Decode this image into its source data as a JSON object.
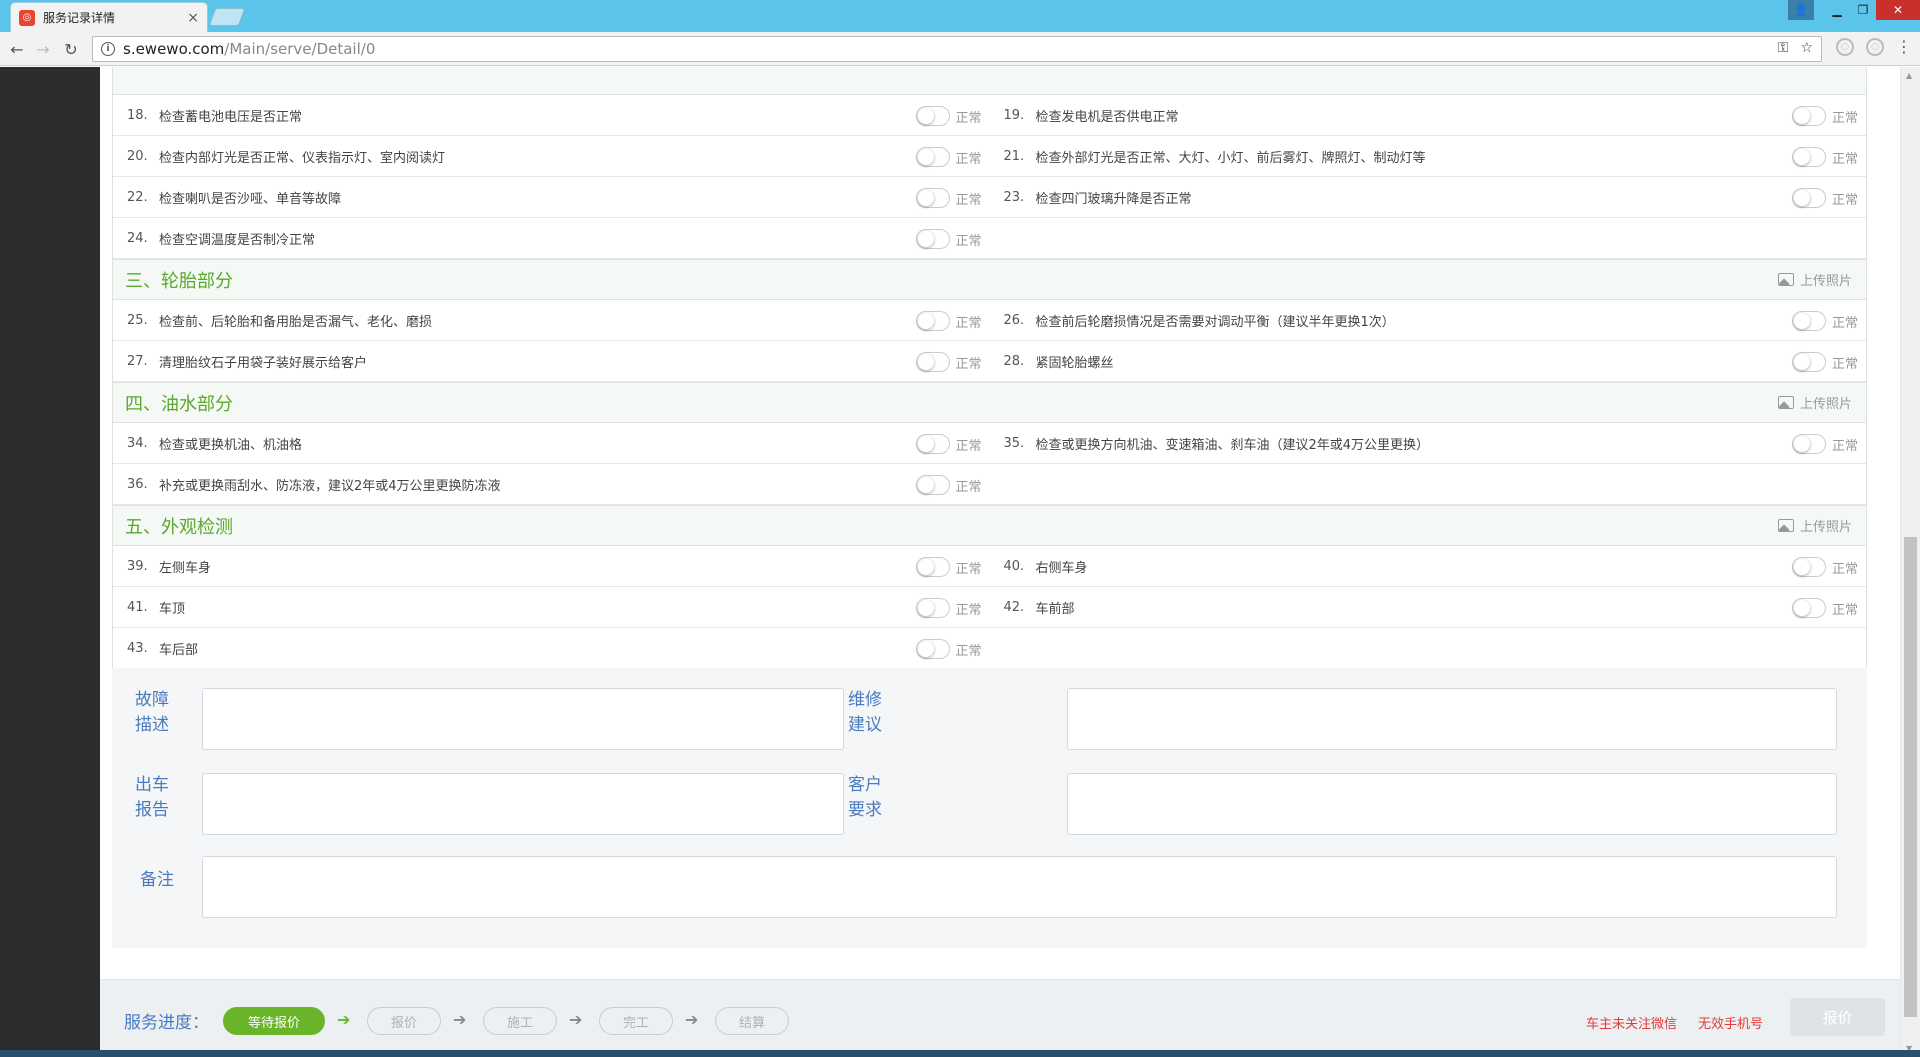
{
  "browser": {
    "tab_title": "服务记录详情",
    "url_host": "s.ewewo.com",
    "url_path": "/Main/serve/Detail/0"
  },
  "status_label": "正常",
  "upload_label": "上传照片",
  "sections": [
    {
      "title": "",
      "show_upload": false,
      "rows": [
        [
          {
            "num": "18.",
            "text": "检查蓄电池电压是否正常"
          },
          {
            "num": "19.",
            "text": "检查发电机是否供电正常"
          }
        ],
        [
          {
            "num": "20.",
            "text": "检查内部灯光是否正常、仪表指示灯、室内阅读灯"
          },
          {
            "num": "21.",
            "text": "检查外部灯光是否正常、大灯、小灯、前后雾灯、牌照灯、制动灯等"
          }
        ],
        [
          {
            "num": "22.",
            "text": "检查喇叭是否沙哑、单音等故障"
          },
          {
            "num": "23.",
            "text": "检查四门玻璃升降是否正常"
          }
        ],
        [
          {
            "num": "24.",
            "text": "检查空调温度是否制冷正常"
          },
          null
        ]
      ]
    },
    {
      "title": "三、轮胎部分",
      "show_upload": true,
      "rows": [
        [
          {
            "num": "25.",
            "text": "检查前、后轮胎和备用胎是否漏气、老化、磨损"
          },
          {
            "num": "26.",
            "text": "检查前后轮磨损情况是否需要对调动平衡（建议半年更换1次）"
          }
        ],
        [
          {
            "num": "27.",
            "text": "清理胎纹石子用袋子装好展示给客户"
          },
          {
            "num": "28.",
            "text": "紧固轮胎螺丝"
          }
        ]
      ]
    },
    {
      "title": "四、油水部分",
      "show_upload": true,
      "rows": [
        [
          {
            "num": "34.",
            "text": "检查或更换机油、机油格"
          },
          {
            "num": "35.",
            "text": "检查或更换方向机油、变速箱油、刹车油（建议2年或4万公里更换）"
          }
        ],
        [
          {
            "num": "36.",
            "text": "补充或更换雨刮水、防冻液，建议2年或4万公里更换防冻液"
          },
          null
        ]
      ]
    },
    {
      "title": "五、外观检测",
      "show_upload": true,
      "rows": [
        [
          {
            "num": "39.",
            "text": "左侧车身"
          },
          {
            "num": "40.",
            "text": "右侧车身"
          }
        ],
        [
          {
            "num": "41.",
            "text": "车顶"
          },
          {
            "num": "42.",
            "text": "车前部"
          }
        ],
        [
          {
            "num": "43.",
            "text": "车后部"
          },
          null
        ]
      ]
    }
  ],
  "notes": {
    "fault_desc_label": "故障描述",
    "repair_advice_label": "维修建议",
    "exit_report_label": "出车报告",
    "customer_req_label": "客户要求",
    "remarks_label": "备注"
  },
  "progress": {
    "label": "服务进度：",
    "steps": [
      "等待报价",
      "报价",
      "施工",
      "完工",
      "结算"
    ],
    "active_index": 0,
    "warning_wechat": "车主未关注微信",
    "warning_phone": "无效手机号",
    "quote_button": "报价"
  },
  "colors": {
    "accent_green": "#6ab42a",
    "section_title": "#5aa82c",
    "label_blue": "#4a7bbf",
    "warning_red": "#e03c3c"
  }
}
